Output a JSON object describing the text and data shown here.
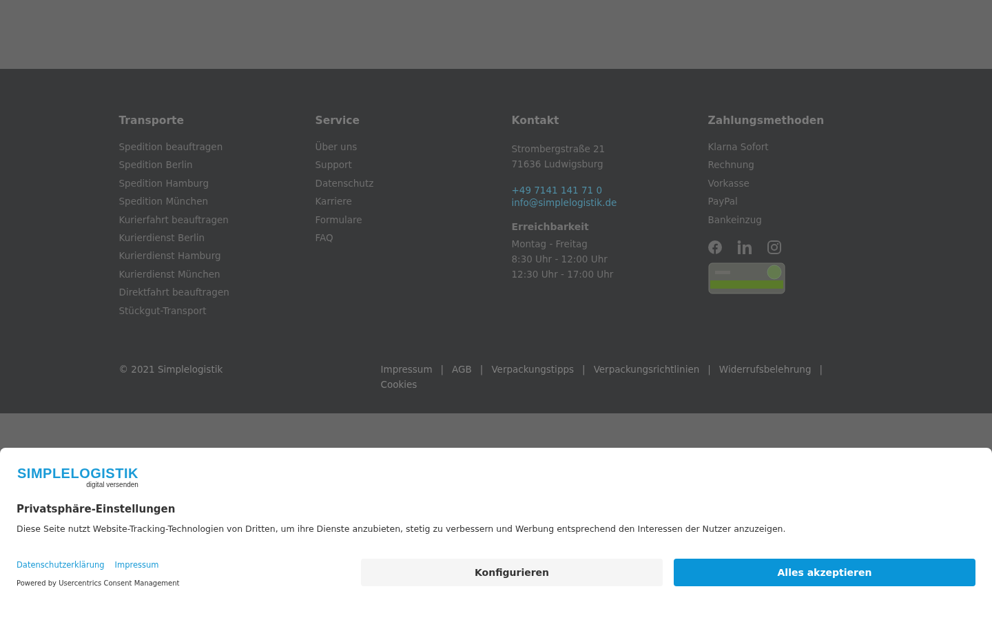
{
  "footer": {
    "columns": [
      {
        "title": "Transporte",
        "items": [
          "Spedition beauftragen",
          "Spedition Berlin",
          "Spedition Hamburg",
          "Spedition München",
          "Kurierfahrt beauftragen",
          "Kurierdienst Berlin",
          "Kurierdienst Hamburg",
          "Kurierdienst München",
          "Direktfahrt beauftragen",
          "Stückgut-Transport"
        ]
      },
      {
        "title": "Service",
        "items": [
          "Über uns",
          "Support",
          "Datenschutz",
          "Karriere",
          "Formulare",
          "FAQ"
        ]
      },
      {
        "title": "Kontakt",
        "kind": "contact",
        "address": [
          "Strombergstraße 21",
          "71636 Ludwigsburg"
        ],
        "links": [
          "+49 7141 141 71 0",
          "info@simplelogistik.de"
        ],
        "subtitle": "Erreichbarkeit",
        "hours": [
          "Montag - Freitag",
          "8:30 Uhr - 12:00 Uhr",
          "12:30 Uhr - 17:00 Uhr"
        ]
      },
      {
        "title": "Zahlungsmethoden",
        "kind": "payment",
        "items": [
          "Klarna Sofort",
          "Rechnung",
          "Vorkasse",
          "PayPal",
          "Bankeinzug"
        ]
      }
    ],
    "copyright": "© 2021 Simplelogistik",
    "legal_links": [
      "Impressum",
      "AGB",
      "Verpackungstipps",
      "Verpackungsrichtlinien",
      "Widerrufsbelehrung",
      "Cookies"
    ],
    "legal_separators": [
      "|",
      "|",
      "|",
      "|",
      "|"
    ]
  },
  "consent": {
    "logo": {
      "name": "SIMPLELOGISTIK",
      "tagline": "digital versenden"
    },
    "title": "Privatsphäre-Einstellungen",
    "text": "Diese Seite nutzt Website-Tracking-Technologien von Dritten, um ihre Dienste anzubieten, stetig zu verbessern und Werbung entsprechend den Interessen der Nutzer anzuzeigen.",
    "links": [
      "Datenschutzerklärung",
      "Impressum"
    ],
    "powered_by": "Powered by Usercentrics Consent Management",
    "buttons": [
      {
        "label": "Konfigurieren",
        "kind": "secondary"
      },
      {
        "label": "Alles akzeptieren",
        "kind": "primary"
      }
    ]
  }
}
